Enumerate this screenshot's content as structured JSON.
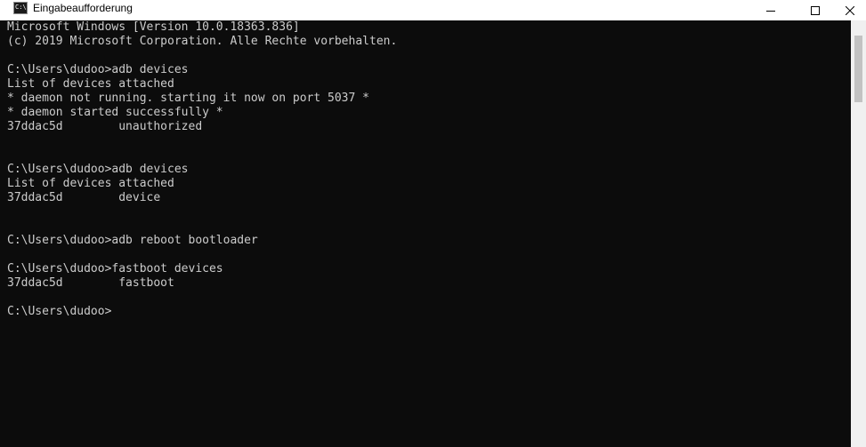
{
  "window": {
    "title": "Eingabeaufforderung",
    "icon": "command-prompt-icon",
    "icon_glyph": "C:\\",
    "controls": [
      "minimize-icon",
      "maximize-icon",
      "close-icon"
    ]
  },
  "console": {
    "background": "#0c0c0c",
    "foreground": "#cccccc",
    "lines": [
      "Microsoft Windows [Version 10.0.18363.836]",
      "(c) 2019 Microsoft Corporation. Alle Rechte vorbehalten.",
      "",
      "C:\\Users\\dudoo>adb devices",
      "List of devices attached",
      "* daemon not running. starting it now on port 5037 *",
      "* daemon started successfully *",
      "37ddac5d        unauthorized",
      "",
      "",
      "C:\\Users\\dudoo>adb devices",
      "List of devices attached",
      "37ddac5d        device",
      "",
      "",
      "C:\\Users\\dudoo>adb reboot bootloader",
      "",
      "C:\\Users\\dudoo>fastboot devices",
      "37ddac5d        fastboot",
      "",
      "C:\\Users\\dudoo>"
    ]
  }
}
